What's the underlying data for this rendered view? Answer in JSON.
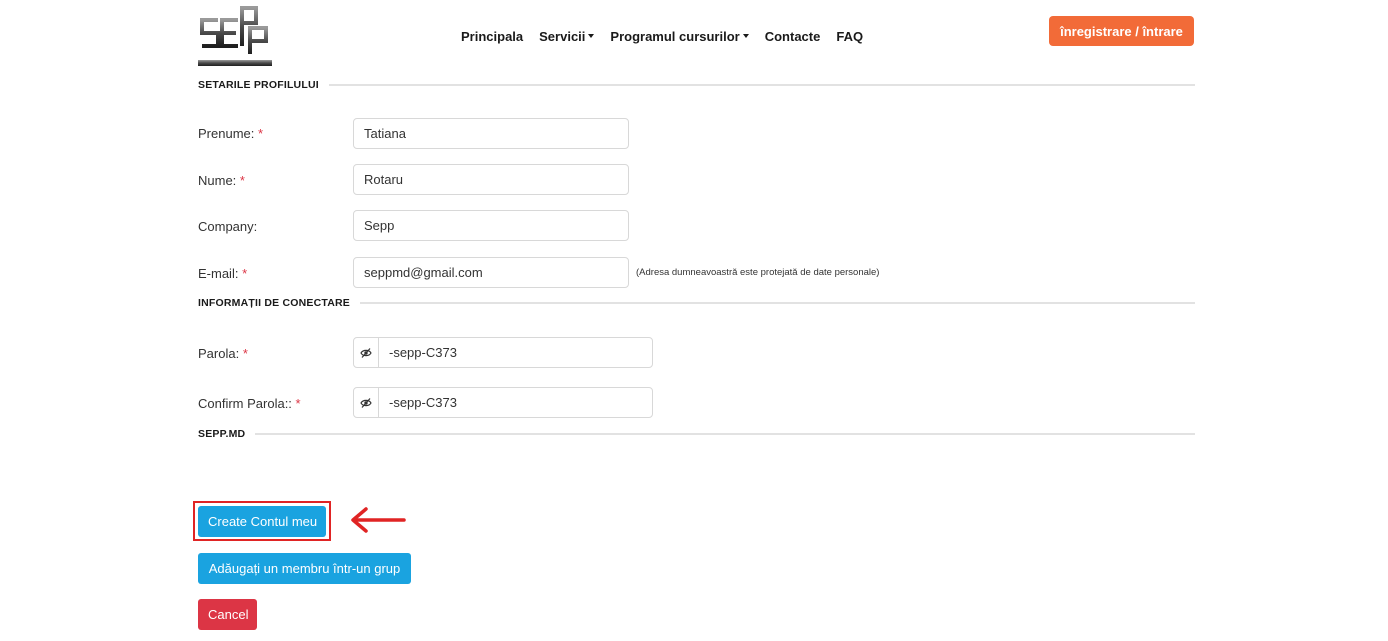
{
  "header": {
    "nav": [
      {
        "label": "Principala",
        "dropdown": false
      },
      {
        "label": "Servicii",
        "dropdown": true
      },
      {
        "label": "Programul cursurilor",
        "dropdown": true
      },
      {
        "label": "Contacte",
        "dropdown": false
      },
      {
        "label": "FAQ",
        "dropdown": false
      }
    ],
    "login_label": "înregistrare / întrare"
  },
  "sections": {
    "profile": "SETARILE PROFILULUI",
    "login_info": "INFORMAȚII DE CONECTARE",
    "site": "SEPP.MD"
  },
  "form": {
    "first_name": {
      "label": "Prenume:",
      "value": "Tatiana",
      "required": "*"
    },
    "last_name": {
      "label": "Nume:",
      "value": "Rotaru",
      "required": "*"
    },
    "company": {
      "label": "Company:",
      "value": "Sepp"
    },
    "email": {
      "label": "E-mail:",
      "value": "seppmd@gmail.com",
      "required": "*",
      "note": "(Adresa dumneavoastră este protejată de date personale)"
    },
    "password": {
      "label": "Parola:",
      "value": "-sepp-C373",
      "required": "*"
    },
    "confirm_password": {
      "label": "Confirm Parola::",
      "value": "-sepp-C373",
      "required": "*"
    }
  },
  "buttons": {
    "create": "Create Contul meu",
    "add_group": "Adăugați un membru într-un grup",
    "cancel": "Cancel"
  },
  "colors": {
    "accent_orange": "#f26b38",
    "button_blue": "#1aa3e0",
    "button_red": "#dc3545",
    "annotation_red": "#e02424"
  },
  "icons": {
    "password_toggle": "eye-slash-icon",
    "annotation": "arrow-left-icon"
  }
}
